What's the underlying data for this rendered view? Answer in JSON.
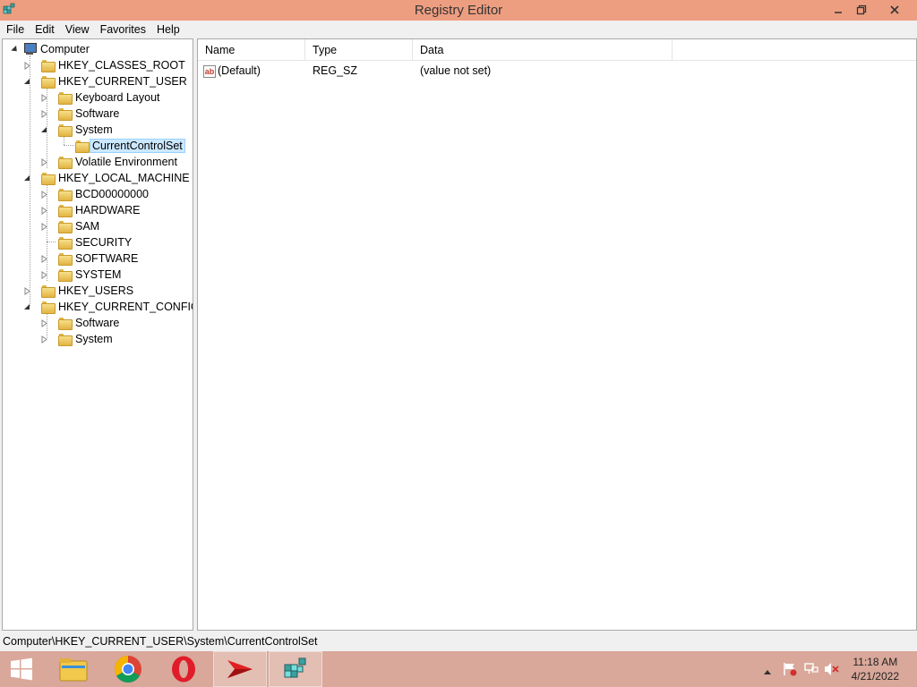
{
  "window": {
    "title": "Registry Editor"
  },
  "menu": {
    "items": [
      "File",
      "Edit",
      "View",
      "Favorites",
      "Help"
    ]
  },
  "tree": {
    "root": "Computer",
    "nodes": [
      {
        "label": "HKEY_CLASSES_ROOT",
        "level": 1,
        "expanded": false
      },
      {
        "label": "HKEY_CURRENT_USER",
        "level": 1,
        "expanded": true
      },
      {
        "label": "Keyboard Layout",
        "level": 2,
        "expanded": false
      },
      {
        "label": "Software",
        "level": 2,
        "expanded": false
      },
      {
        "label": "System",
        "level": 2,
        "expanded": true
      },
      {
        "label": "CurrentControlSet",
        "level": 3,
        "expanded": null,
        "selected": true
      },
      {
        "label": "Volatile Environment",
        "level": 2,
        "expanded": false
      },
      {
        "label": "HKEY_LOCAL_MACHINE",
        "level": 1,
        "expanded": true
      },
      {
        "label": "BCD00000000",
        "level": 2,
        "expanded": false
      },
      {
        "label": "HARDWARE",
        "level": 2,
        "expanded": false
      },
      {
        "label": "SAM",
        "level": 2,
        "expanded": false
      },
      {
        "label": "SECURITY",
        "level": 2,
        "expanded": null
      },
      {
        "label": "SOFTWARE",
        "level": 2,
        "expanded": false
      },
      {
        "label": "SYSTEM",
        "level": 2,
        "expanded": false
      },
      {
        "label": "HKEY_USERS",
        "level": 1,
        "expanded": false
      },
      {
        "label": "HKEY_CURRENT_CONFIG",
        "level": 1,
        "expanded": true
      },
      {
        "label": "Software",
        "level": 2,
        "expanded": false
      },
      {
        "label": "System",
        "level": 2,
        "expanded": false
      }
    ]
  },
  "values": {
    "columns": [
      "Name",
      "Type",
      "Data"
    ],
    "rows": [
      {
        "name": "(Default)",
        "type": "REG_SZ",
        "data": "(value not set)",
        "icon": "string-value-icon"
      }
    ]
  },
  "status": {
    "path": "Computer\\HKEY_CURRENT_USER\\System\\CurrentControlSet"
  },
  "taskbar": {
    "apps": [
      "start",
      "file-explorer",
      "chrome",
      "opera",
      "foxit-reader",
      "registry-editor"
    ],
    "active": "registry-editor",
    "time": "11:18 AM",
    "date": "4/21/2022"
  },
  "colors": {
    "titlebar": "#ee9e80",
    "taskbar": "#d9a89a",
    "selection": "#cce8ff"
  }
}
